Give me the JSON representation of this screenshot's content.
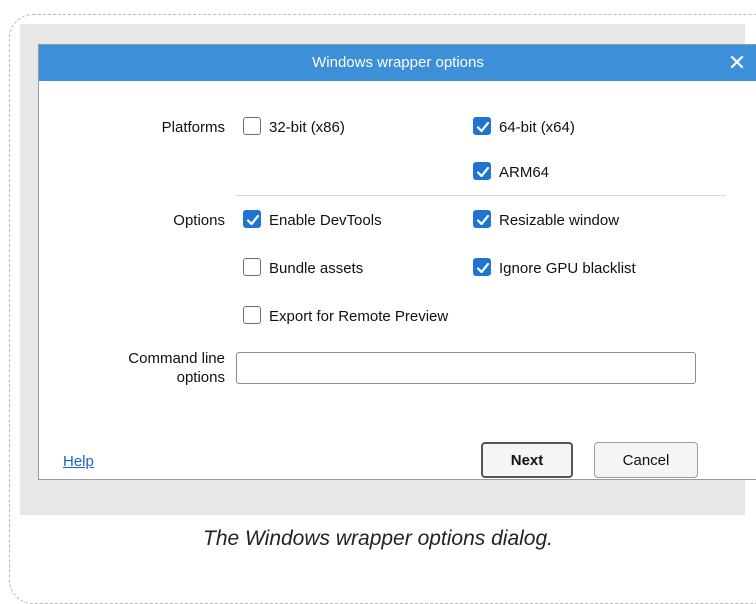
{
  "dialog": {
    "title": "Windows wrapper options",
    "close_icon": "close-icon"
  },
  "platforms": {
    "label": "Platforms",
    "items": [
      {
        "label": "32-bit (x86)",
        "checked": false
      },
      {
        "label": "64-bit (x64)",
        "checked": true
      },
      {
        "label": "ARM64",
        "checked": true
      }
    ]
  },
  "options": {
    "label": "Options",
    "items": [
      {
        "label": "Enable DevTools",
        "checked": true
      },
      {
        "label": "Resizable window",
        "checked": true
      },
      {
        "label": "Bundle assets",
        "checked": false
      },
      {
        "label": "Ignore GPU blacklist",
        "checked": true
      },
      {
        "label": "Export for Remote Preview",
        "checked": false
      }
    ]
  },
  "command_line": {
    "label_line1": "Command line",
    "label_line2": "options",
    "value": ""
  },
  "footer": {
    "help_label": "Help",
    "next_label": "Next",
    "cancel_label": "Cancel"
  },
  "caption": "The Windows wrapper options dialog.",
  "colors": {
    "titlebar": "#3d8fd8",
    "checkbox_checked": "#1f73d2",
    "link": "#1a63c9"
  }
}
